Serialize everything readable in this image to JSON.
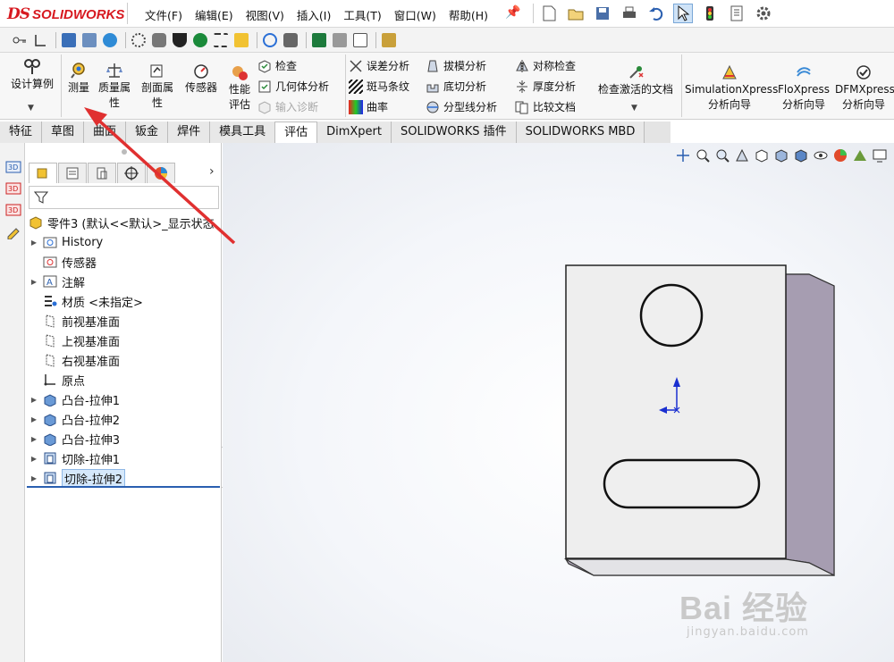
{
  "app": {
    "brand": "SOLIDWORKS",
    "brand_mark": "DS"
  },
  "menu": [
    "文件(F)",
    "编辑(E)",
    "视图(V)",
    "插入(I)",
    "工具(T)",
    "窗口(W)",
    "帮助(H)"
  ],
  "ribbon": {
    "design_study": "设计算例",
    "measure": "测量",
    "mass_props_1": "质量属",
    "mass_props_2": "性",
    "section_props_1": "剖面属",
    "section_props_2": "性",
    "sensor": "传感器",
    "perf_eval_1": "性能",
    "perf_eval_2": "评估",
    "check": "检查",
    "geometry_analysis": "几何体分析",
    "import_diagnostics": "输入诊断",
    "deviation_analysis": "误差分析",
    "zebra_stripes": "斑马条纹",
    "curvature": "曲率",
    "draft_analysis": "拔模分析",
    "undercut_analysis": "底切分析",
    "parting_line_analysis": "分型线分析",
    "symmetry_check": "对称检查",
    "thickness_analysis": "厚度分析",
    "compare_documents": "比较文档",
    "check_active_doc": "检查激活的文档",
    "simxpress_1": "SimulationXpress",
    "simxpress_2": "分析向导",
    "floxpress_1": "FloXpress",
    "floxpress_2": "分析向导",
    "dfmxpress_1": "DFMXpress",
    "dfmxpress_2": "分析向导"
  },
  "tabs": [
    "特征",
    "草图",
    "曲面",
    "钣金",
    "焊件",
    "模具工具",
    "评估",
    "DimXpert",
    "SOLIDWORKS 插件",
    "SOLIDWORKS MBD"
  ],
  "active_tab": "评估",
  "tree": {
    "root": "零件3 (默认<<默认>_显示状态",
    "items": [
      {
        "label": "History",
        "expandable": true
      },
      {
        "label": "传感器",
        "expandable": false
      },
      {
        "label": "注解",
        "expandable": true
      },
      {
        "label": "材质 <未指定>",
        "expandable": false
      },
      {
        "label": "前视基准面",
        "expandable": false
      },
      {
        "label": "上视基准面",
        "expandable": false
      },
      {
        "label": "右视基准面",
        "expandable": false
      },
      {
        "label": "原点",
        "expandable": false
      },
      {
        "label": "凸台-拉伸1",
        "expandable": true
      },
      {
        "label": "凸台-拉伸2",
        "expandable": true
      },
      {
        "label": "凸台-拉伸3",
        "expandable": true
      },
      {
        "label": "切除-拉伸1",
        "expandable": true
      },
      {
        "label": "切除-拉伸2",
        "expandable": true
      }
    ]
  },
  "watermark": {
    "brand": "Bai 经验",
    "url": "jingyan.baidu.com"
  },
  "colors": {
    "brand_red": "#d71920",
    "annotation_arrow": "#e03030",
    "part_face": "#eeeeee",
    "part_side": "#b5aebd"
  }
}
